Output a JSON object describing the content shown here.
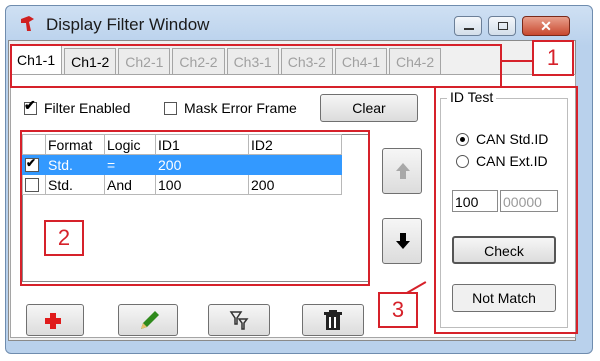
{
  "window": {
    "title": "Display Filter Window"
  },
  "titlebar_buttons": [
    {
      "name": "minimize-icon",
      "glyph": "▭"
    },
    {
      "name": "maximize-icon",
      "glyph": "▣"
    },
    {
      "name": "close-icon",
      "glyph": "✕"
    }
  ],
  "tabs": [
    {
      "label": "Ch1-1",
      "state": "active"
    },
    {
      "label": "Ch1-2",
      "state": "normal"
    },
    {
      "label": "Ch2-1",
      "state": "disabled"
    },
    {
      "label": "Ch2-2",
      "state": "disabled"
    },
    {
      "label": "Ch3-1",
      "state": "disabled"
    },
    {
      "label": "Ch3-2",
      "state": "disabled"
    },
    {
      "label": "Ch4-1",
      "state": "disabled"
    },
    {
      "label": "Ch4-2",
      "state": "disabled"
    }
  ],
  "filter_enabled": {
    "label": "Filter Enabled",
    "checked": true
  },
  "mask_error_frame": {
    "label": "Mask Error Frame",
    "checked": false
  },
  "clear_button": "Clear",
  "table": {
    "columns": [
      "",
      "Format",
      "Logic",
      "ID1",
      "ID2"
    ],
    "rows": [
      {
        "checked": true,
        "format": "Std.",
        "logic": "=",
        "id1": "200",
        "id2": "",
        "selected": true
      },
      {
        "checked": false,
        "format": "Std.",
        "logic": "And",
        "id1": "100",
        "id2": "200",
        "selected": false
      }
    ]
  },
  "id_test": {
    "title": "ID Test",
    "radio_std": "CAN Std.ID",
    "radio_ext": "CAN Ext.ID",
    "selected": "std",
    "id_value": "100",
    "id_hex": "00000",
    "check_button": "Check",
    "result": "Not Match"
  },
  "bottom_buttons": [
    {
      "name": "add-icon",
      "glyph": "✚",
      "color": "#e01b1b"
    },
    {
      "name": "edit-pencil-icon",
      "glyph": "✎",
      "color": "#2f8a1c"
    },
    {
      "name": "filter-icon",
      "glyph": "⧩",
      "color": "#333333"
    },
    {
      "name": "delete-trash-icon",
      "glyph": "🗑",
      "color": "#222222"
    }
  ],
  "callouts": [
    "1",
    "2",
    "3"
  ],
  "colors": {
    "highlight": "#d6212a",
    "selection": "#3399ff"
  }
}
